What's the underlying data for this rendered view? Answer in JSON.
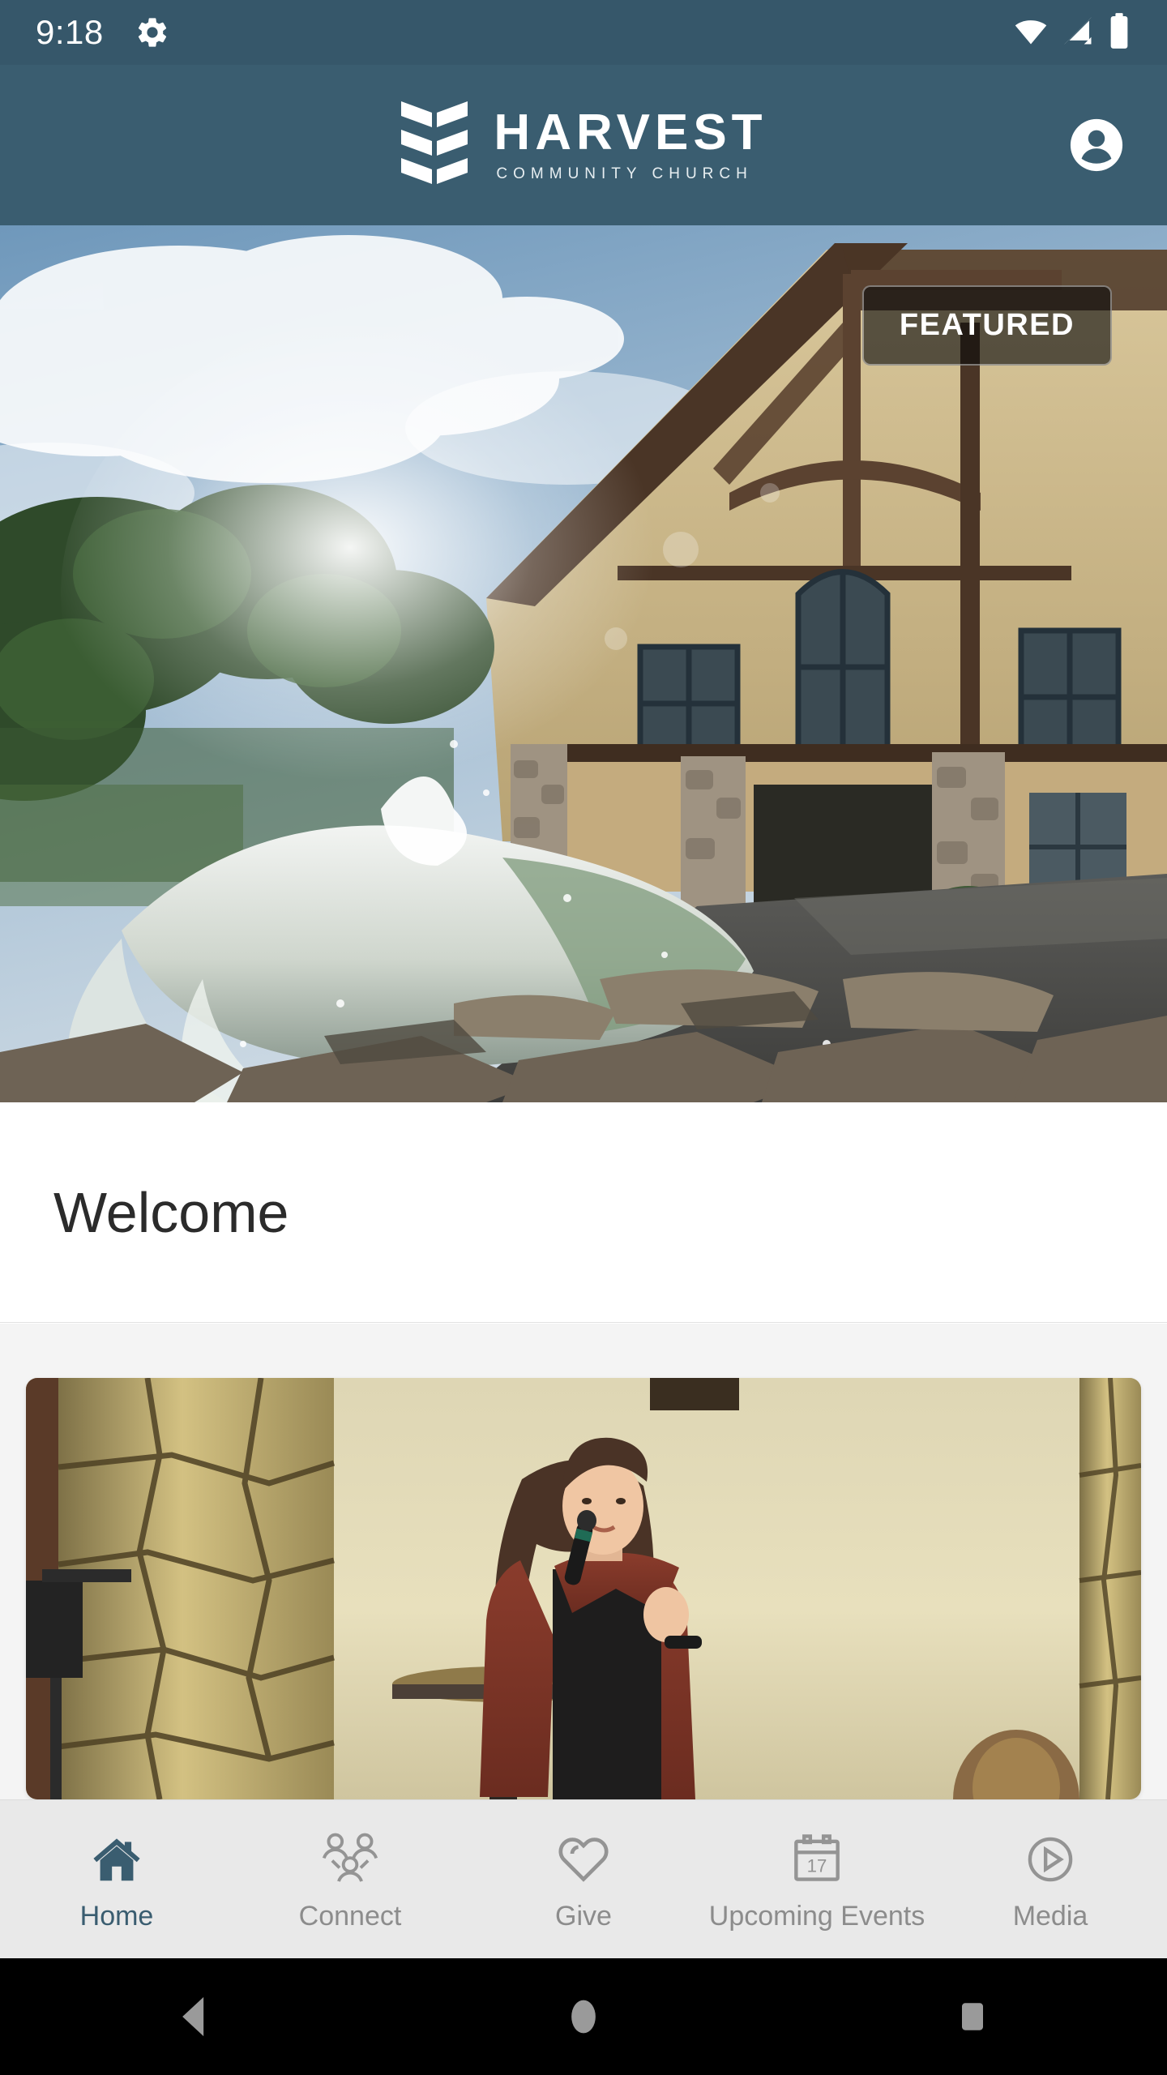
{
  "status_bar": {
    "time": "9:18",
    "gear_icon": "gear-icon",
    "wifi_icon": "wifi-icon",
    "cellular_icon": "cellular-signal-icon",
    "battery_icon": "battery-icon",
    "background_color": "#36576a"
  },
  "app_header": {
    "logo_icon": "harvest-wheat-logo-icon",
    "brand_title": "HARVEST",
    "brand_subtitle": "COMMUNITY CHURCH",
    "account_icon": "account-avatar-icon",
    "background_color": "#3a5d70"
  },
  "hero": {
    "badge_label": "FEATURED",
    "image_description": "church-building-fountain-photo"
  },
  "welcome": {
    "title": "Welcome"
  },
  "media_card": {
    "image_description": "woman-speaking-at-podium-photo"
  },
  "tab_bar": {
    "active_color": "#3a5d70",
    "inactive_color": "#8c8c8c",
    "items": [
      {
        "label": "Home",
        "icon": "home-icon",
        "active": true
      },
      {
        "label": "Connect",
        "icon": "people-group-icon",
        "active": false
      },
      {
        "label": "Give",
        "icon": "heart-icon",
        "active": false
      },
      {
        "label": "Upcoming Events",
        "icon": "calendar-17-icon",
        "active": false
      },
      {
        "label": "Media",
        "icon": "play-circle-icon",
        "active": false
      }
    ],
    "calendar_day": "17"
  },
  "android_nav": {
    "back_icon": "back-triangle-icon",
    "home_icon": "home-circle-icon",
    "recents_icon": "recents-square-icon"
  }
}
